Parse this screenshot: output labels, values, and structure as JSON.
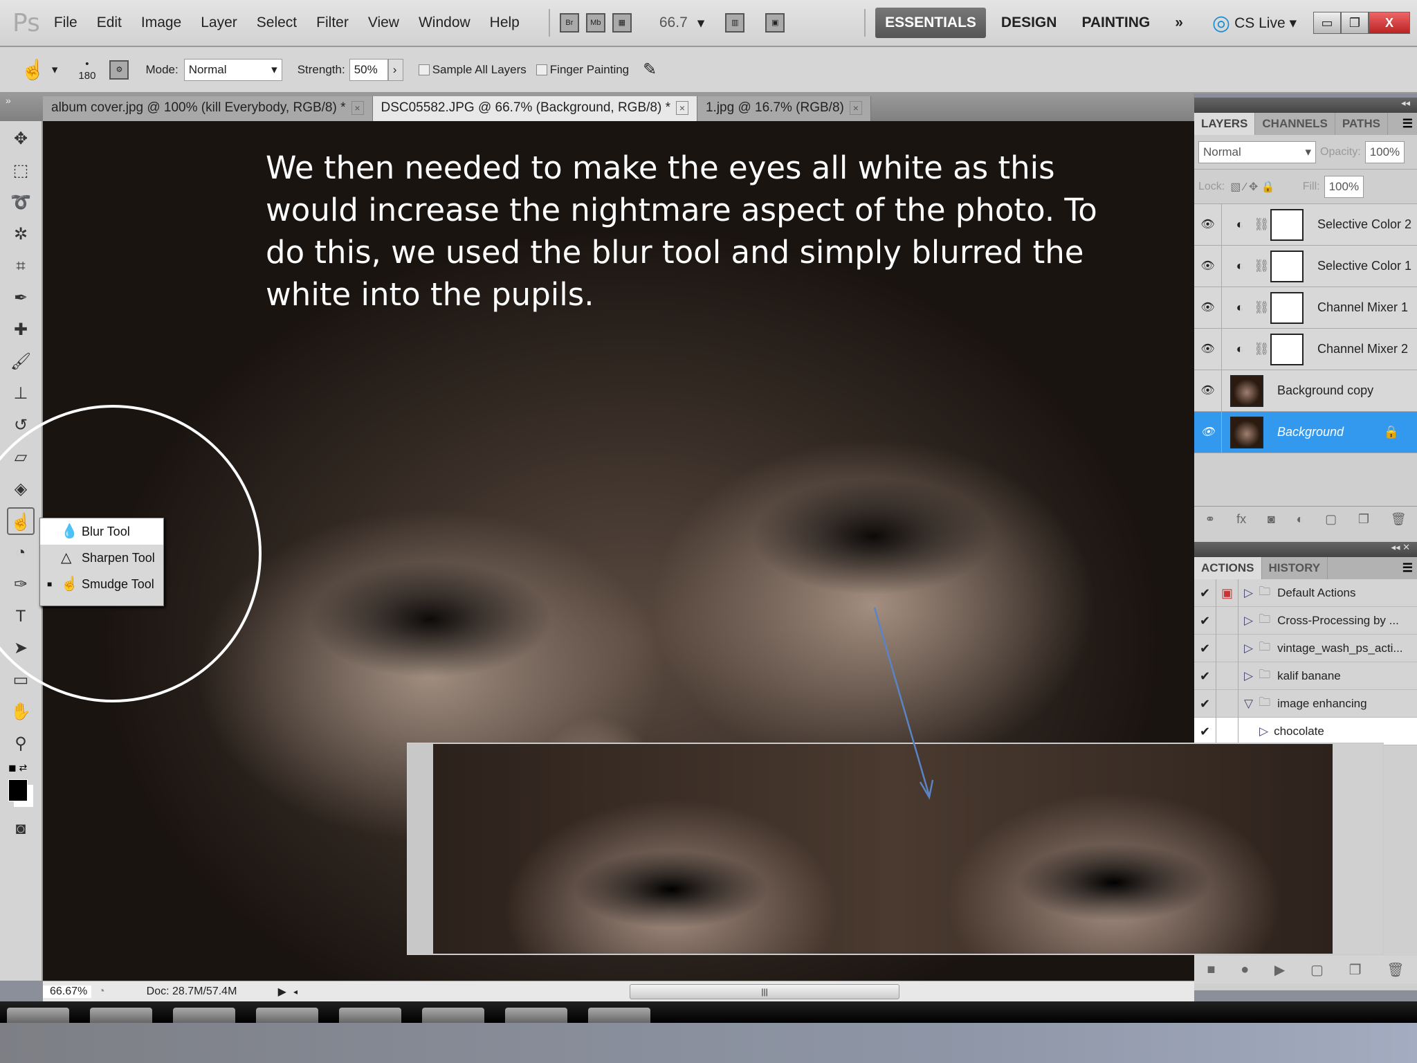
{
  "menubar": {
    "logo": "Ps",
    "items": [
      "File",
      "Edit",
      "Image",
      "Layer",
      "Select",
      "Filter",
      "View",
      "Window",
      "Help"
    ],
    "bridge": "Br",
    "minibridge": "Mb",
    "zoom": "66.7",
    "workspaces": [
      "ESSENTIALS",
      "DESIGN",
      "PAINTING"
    ],
    "more": "»",
    "cslive": "CS Live ▾",
    "window_buttons": {
      "minimize": "▭",
      "restore": "❐",
      "close": "X"
    }
  },
  "options": {
    "brush_size": "180",
    "mode_label": "Mode:",
    "mode_value": "Normal",
    "strength_label": "Strength:",
    "strength_value": "50%",
    "sample_all_layers": "Sample All Layers",
    "finger_painting": "Finger Painting"
  },
  "tabs": [
    {
      "label": "album cover.jpg @ 100% (kill Everybody, RGB/8) *"
    },
    {
      "label": "DSC05582.JPG @ 66.7% (Background, RGB/8) *"
    },
    {
      "label": "1.jpg @ 16.7% (RGB/8)"
    }
  ],
  "caption": "We then needed to make the eyes all white as this would increase the nightmare aspect of the photo. To do this, we used the blur tool and simply blurred the white into the pupils.",
  "flyout": [
    "Blur Tool",
    "Sharpen Tool",
    "Smudge Tool"
  ],
  "layers_panel": {
    "tabs": [
      "LAYERS",
      "CHANNELS",
      "PATHS"
    ],
    "blend": "Normal",
    "opacity_label": "Opacity:",
    "opacity": "100%",
    "lock_label": "Lock:",
    "fill_label": "Fill:",
    "fill": "100%",
    "layers": [
      {
        "name": "Selective Color 2"
      },
      {
        "name": "Selective Color 1"
      },
      {
        "name": "Channel Mixer 1"
      },
      {
        "name": "Channel Mixer 2"
      },
      {
        "name": "Background copy"
      },
      {
        "name": "Background"
      }
    ]
  },
  "actions_panel": {
    "tabs": [
      "ACTIONS",
      "HISTORY"
    ],
    "items": [
      {
        "name": "Default Actions"
      },
      {
        "name": "Cross-Processing by ..."
      },
      {
        "name": "vintage_wash_ps_acti..."
      },
      {
        "name": "kalif banane"
      },
      {
        "name": "image enhancing"
      },
      {
        "name": "chocolate"
      }
    ]
  },
  "status": {
    "zoom": "66.67%",
    "doc": "Doc: 28.7M/57.4M"
  },
  "colors": {
    "accent": "#3399ee",
    "panel": "#d4d4d4",
    "arrow": "#5b84c4"
  }
}
